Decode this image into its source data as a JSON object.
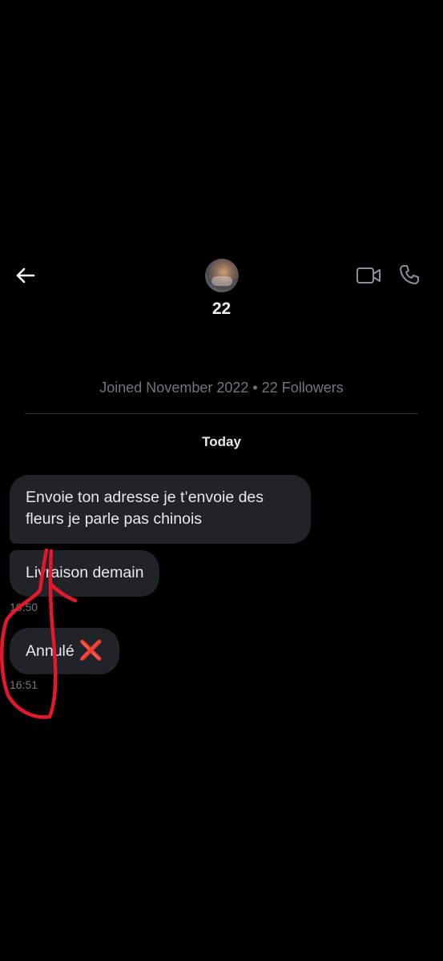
{
  "header": {
    "contact_name": "22",
    "back_icon": "arrow-left-icon",
    "video_icon": "video-camera-icon",
    "call_icon": "phone-icon"
  },
  "profile": {
    "meta": "Joined November 2022 • 22 Followers"
  },
  "conversation": {
    "day_label": "Today",
    "messages": [
      {
        "text": "Envoie ton adresse je t’envoie des fleurs je parle pas chinois"
      },
      {
        "text": "Livraison demain",
        "time": "16:50"
      },
      {
        "text": "Annulé",
        "emoji": "❌",
        "time": "16:51"
      }
    ]
  },
  "colors": {
    "background": "#000000",
    "bubble": "#202327",
    "muted_text": "#71767b",
    "annotation": "#e3182d"
  }
}
